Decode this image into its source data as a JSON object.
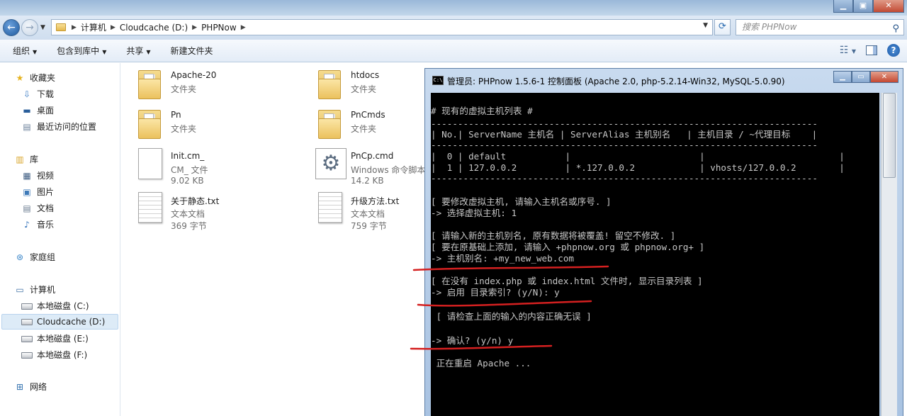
{
  "address": {
    "crumbs": [
      "计算机",
      "Cloudcache (D:)",
      "PHPNow"
    ],
    "search_placeholder": "搜索 PHPNow"
  },
  "toolbar": {
    "organize": "组织",
    "include": "包含到库中",
    "share": "共享",
    "new_folder": "新建文件夹"
  },
  "sidebar": {
    "favorites": "收藏夹",
    "downloads": "下载",
    "desktop": "桌面",
    "recent": "最近访问的位置",
    "libraries": "库",
    "videos": "视频",
    "pictures": "图片",
    "documents": "文档",
    "music": "音乐",
    "homegroup": "家庭组",
    "computer": "计算机",
    "drive_c": "本地磁盘 (C:)",
    "drive_d": "Cloudcache (D:)",
    "drive_e": "本地磁盘 (E:)",
    "drive_f": "本地磁盘 (F:)",
    "network": "网络"
  },
  "files": [
    {
      "name": "Apache-20",
      "type": "文件夹",
      "size": ""
    },
    {
      "name": "htdocs",
      "type": "文件夹",
      "size": ""
    },
    {
      "name": "Pn",
      "type": "文件夹",
      "size": ""
    },
    {
      "name": "PnCmds",
      "type": "文件夹",
      "size": ""
    },
    {
      "name": "Init.cm_",
      "type": "CM_ 文件",
      "size": "9.02 KB"
    },
    {
      "name": "PnCp.cmd",
      "type": "Windows 命令脚本",
      "size": "14.2 KB"
    },
    {
      "name": "关于静态.txt",
      "type": "文本文档",
      "size": "369 字节"
    },
    {
      "name": "升级方法.txt",
      "type": "文本文档",
      "size": "759 字节"
    }
  ],
  "console": {
    "title": "管理员:  PHPnow 1.5.6-1 控制面板 (Apache 2.0, php-5.2.14-Win32, MySQL-5.0.90)",
    "lines": [
      "# 现有的虚拟主机列表 #",
      "------------------------------------------------------------------------",
      "| No.| ServerName 主机名 | ServerAlias 主机别名   | 主机目录 / ~代理目标    |",
      "------------------------------------------------------------------------",
      "|  0 | default           |                        |                         |",
      "|  1 | 127.0.0.2         | *.127.0.0.2            | vhosts/127.0.0.2        |",
      "------------------------------------------------------------------------",
      "[ 要修改虚拟主机, 请输入主机名或序号. ]",
      "-> 选择虚拟主机: 1",
      "[ 请输入新的主机别名, 原有数据将被覆盖! 留空不修改. ]",
      "[ 要在原基础上添加, 请输入 +phpnow.org 或 phpnow.org+ ]",
      "-> 主机别名: +my_new_web.com",
      "[ 在没有 index.php 或 index.html 文件时, 显示目录列表 ]",
      "-> 启用 目录索引? (y/N): y",
      " [ 请检查上面的输入的内容正确无误 ]",
      "-> 确认? (y/n) y",
      " 正在重启 Apache ..."
    ]
  }
}
